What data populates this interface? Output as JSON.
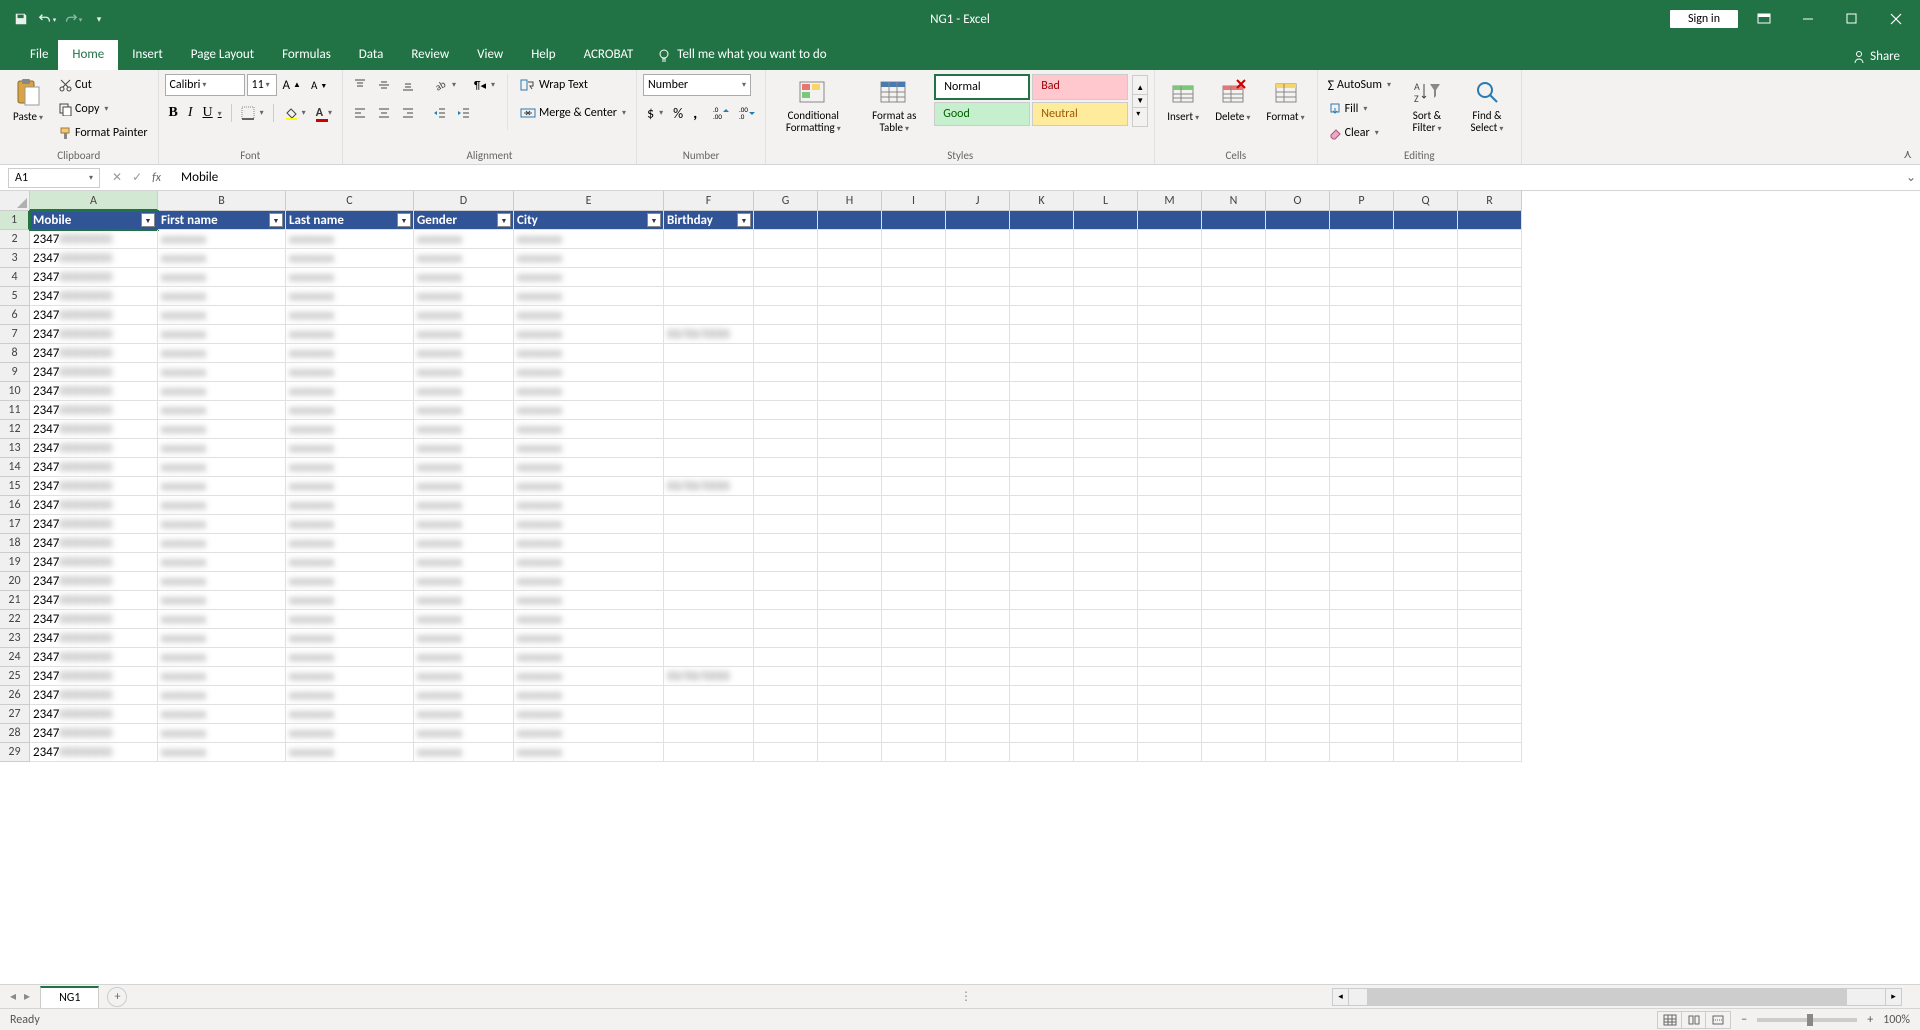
{
  "app_title": "NG1  -  Excel",
  "signin_label": "Sign in",
  "share_label": "Share",
  "tabs": {
    "file": "File",
    "home": "Home",
    "insert": "Insert",
    "page_layout": "Page Layout",
    "formulas": "Formulas",
    "data": "Data",
    "review": "Review",
    "view": "View",
    "help": "Help",
    "acrobat": "ACROBAT",
    "tellme": "Tell me what you want to do"
  },
  "ribbon": {
    "clipboard": {
      "paste": "Paste",
      "cut": "Cut",
      "copy": "Copy",
      "format_painter": "Format Painter",
      "group": "Clipboard"
    },
    "font": {
      "name": "Calibri",
      "size": "11",
      "group": "Font"
    },
    "alignment": {
      "wrap": "Wrap Text",
      "merge": "Merge & Center",
      "group": "Alignment"
    },
    "number": {
      "format": "Number",
      "group": "Number"
    },
    "styles": {
      "conditional": "Conditional Formatting",
      "as_table": "Format as Table",
      "normal": "Normal",
      "bad": "Bad",
      "good": "Good",
      "neutral": "Neutral",
      "group": "Styles"
    },
    "cells": {
      "insert": "Insert",
      "delete": "Delete",
      "format": "Format",
      "group": "Cells"
    },
    "editing": {
      "autosum": "AutoSum",
      "fill": "Fill",
      "clear": "Clear",
      "sort": "Sort & Filter",
      "find": "Find & Select",
      "group": "Editing"
    }
  },
  "name_box": "A1",
  "formula_value": "Mobile",
  "columns": [
    "A",
    "B",
    "C",
    "D",
    "E",
    "F",
    "G",
    "H",
    "I",
    "J",
    "K",
    "L",
    "M",
    "N",
    "O",
    "P",
    "Q",
    "R"
  ],
  "headers": [
    "Mobile",
    "First name",
    "Last name",
    "Gender",
    "City",
    "Birthday"
  ],
  "data_value": "2347",
  "row_count": 28,
  "sheet_name": "NG1",
  "status_ready": "Ready",
  "zoom": "100%"
}
